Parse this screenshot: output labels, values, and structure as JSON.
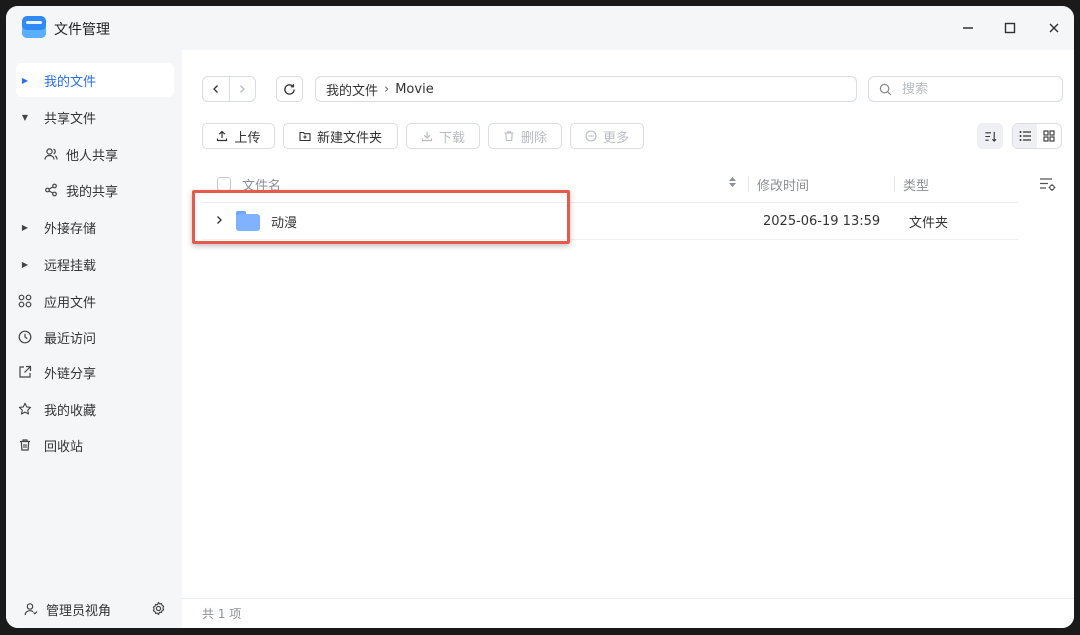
{
  "window": {
    "title": "文件管理",
    "icon": "file-manager-logo"
  },
  "sidebar": {
    "items": [
      {
        "label": "我的文件",
        "icon": "caret-right-icon",
        "active": true
      },
      {
        "label": "共享文件",
        "icon": "caret-down-icon"
      },
      {
        "label": "他人共享",
        "icon": "users-icon"
      },
      {
        "label": "我的共享",
        "icon": "share-icon"
      },
      {
        "label": "外接存储",
        "icon": "caret-right-icon"
      },
      {
        "label": "远程挂载",
        "icon": "caret-right-icon"
      },
      {
        "label": "应用文件",
        "icon": "apps-icon"
      },
      {
        "label": "最近访问",
        "icon": "clock-icon"
      },
      {
        "label": "外链分享",
        "icon": "external-link-icon"
      },
      {
        "label": "我的收藏",
        "icon": "star-icon"
      },
      {
        "label": "回收站",
        "icon": "trash-icon"
      }
    ],
    "footer_label": "管理员视角"
  },
  "breadcrumb": {
    "root": "我的文件",
    "current": "Movie"
  },
  "search": {
    "placeholder": "搜索"
  },
  "toolbar": {
    "upload": "上传",
    "new_folder": "新建文件夹",
    "download": "下载",
    "delete": "删除",
    "more": "更多"
  },
  "table": {
    "columns": {
      "name": "文件名",
      "modified": "修改时间",
      "type": "类型"
    },
    "rows": [
      {
        "name": "动漫",
        "modified": "2025-06-19 13:59",
        "type": "文件夹"
      }
    ]
  },
  "status": {
    "count_text": "共 1 项"
  },
  "colors": {
    "accent": "#2a6ee8",
    "highlight": "#e55a4b",
    "folder": "#7fb3ff"
  }
}
